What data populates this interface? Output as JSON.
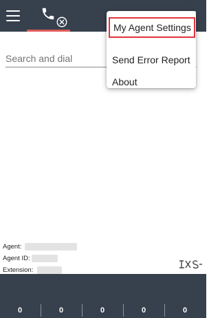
{
  "header": {
    "menu_icon": "hamburger-icon",
    "phone_icon": "phone-icon",
    "status_icon": "close-circle-icon",
    "more_icon": "kebab-icon"
  },
  "search": {
    "placeholder": "Search and dial",
    "value": ""
  },
  "dropdown": {
    "items": [
      {
        "label": "My Agent Settings"
      },
      {
        "label": "Send Error Report"
      },
      {
        "label": "About"
      }
    ]
  },
  "agent": {
    "agent_label": "Agent:",
    "agent_id_label": "Agent ID:",
    "extension_label": "Extension:"
  },
  "stats": [
    "0",
    "0",
    "0",
    "0",
    "0"
  ],
  "colors": {
    "bar_background": "#37404d",
    "tab_underline": "#e05a5a",
    "highlight_border": "#e0343e"
  }
}
